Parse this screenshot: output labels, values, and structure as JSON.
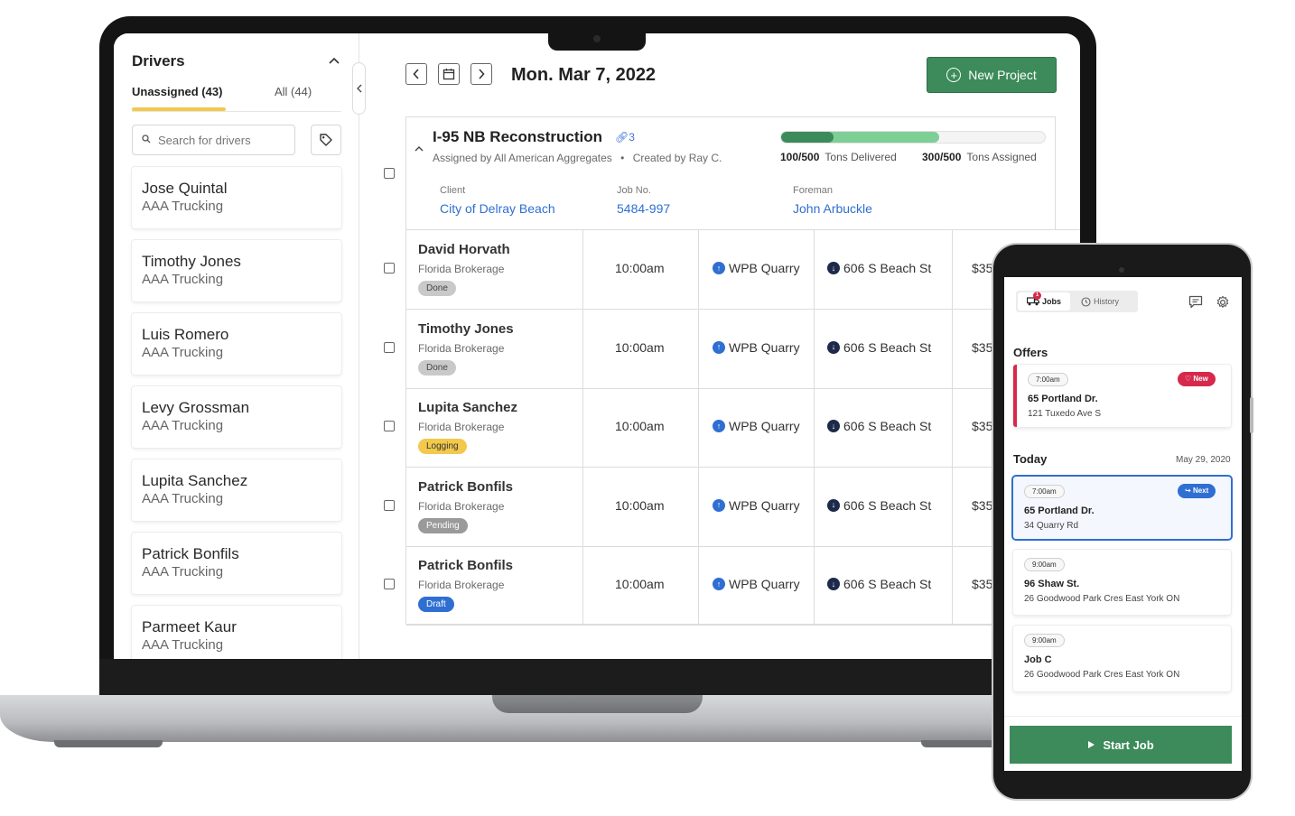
{
  "sidebar": {
    "title": "Drivers",
    "tab_unassigned": "Unassigned (43)",
    "tab_all": "All (44)",
    "search_placeholder": "Search for drivers",
    "drivers": [
      {
        "name": "Jose Quintal",
        "company": "AAA Trucking"
      },
      {
        "name": "Timothy Jones",
        "company": "AAA Trucking"
      },
      {
        "name": "Luis Romero",
        "company": "AAA Trucking"
      },
      {
        "name": "Levy Grossman",
        "company": "AAA Trucking"
      },
      {
        "name": "Lupita Sanchez",
        "company": "AAA Trucking"
      },
      {
        "name": "Patrick Bonfils",
        "company": "AAA Trucking"
      },
      {
        "name": "Parmeet Kaur",
        "company": "AAA Trucking"
      }
    ]
  },
  "header": {
    "date": "Mon. Mar 7, 2022",
    "new_project": "New Project"
  },
  "project": {
    "title": "I-95 NB Reconstruction",
    "link_count": "3",
    "assigned_by": "Assigned by All American Aggregates",
    "created_by": "Created by Ray C.",
    "delivered_value": "100/500",
    "delivered_label": "Tons Delivered",
    "assigned_value": "300/500",
    "assigned_label": "Tons Assigned",
    "delivered_fraction": 0.2,
    "assigned_fraction": 0.6,
    "client_label": "Client",
    "client": "City of Delray Beach",
    "job_label": "Job No.",
    "job_no": "5484-997",
    "foreman_label": "Foreman",
    "foreman": "John Arbuckle"
  },
  "jobs": [
    {
      "driver": "David Horvath",
      "company": "Florida Brokerage",
      "status": "Done",
      "status_color": "#c9c9c9",
      "time": "10:00am",
      "pickup": "WPB Quarry",
      "dropoff": "606 S Beach St",
      "price": "$35"
    },
    {
      "driver": "Timothy Jones",
      "company": "Florida Brokerage",
      "status": "Done",
      "status_color": "#c9c9c9",
      "time": "10:00am",
      "pickup": "WPB Quarry",
      "dropoff": "606 S Beach St",
      "price": "$35"
    },
    {
      "driver": "Lupita Sanchez",
      "company": "Florida Brokerage",
      "status": "Logging",
      "status_color": "#f2c94c",
      "time": "10:00am",
      "pickup": "WPB Quarry",
      "dropoff": "606 S Beach St",
      "price": "$35"
    },
    {
      "driver": "Patrick Bonfils",
      "company": "Florida Brokerage",
      "status": "Pending",
      "status_color": "#9a9a9a",
      "time": "10:00am",
      "pickup": "WPB Quarry",
      "dropoff": "606 S Beach St",
      "price": "$35"
    },
    {
      "driver": "Patrick Bonfils",
      "company": "Florida Brokerage",
      "status": "Draft",
      "status_color": "#2f6fd2",
      "time": "10:00am",
      "pickup": "WPB Quarry",
      "dropoff": "606 S Beach St",
      "price": "$35"
    }
  ],
  "phone": {
    "tab_jobs": "Jobs",
    "jobs_badge": "1",
    "tab_history": "History",
    "offers_heading": "Offers",
    "offer": {
      "time": "7:00am",
      "pill": "New",
      "address": "65 Portland Dr.",
      "sub": "121 Tuxedo Ave S"
    },
    "today_heading": "Today",
    "today_date": "May 29, 2020",
    "today": [
      {
        "time": "7:00am",
        "pill": "Next",
        "address": "65 Portland Dr.",
        "sub": "34 Quarry Rd"
      },
      {
        "time": "9:00am",
        "address": "96 Shaw St.",
        "sub": "26 Goodwood Park Cres East York ON"
      },
      {
        "time": "9:00am",
        "address": "Job C",
        "sub": "26 Goodwood Park Cres East York ON"
      }
    ],
    "start_job": "Start Job"
  },
  "colors": {
    "brand_green": "#3d8b5b",
    "link_blue": "#2f6fd2",
    "accent_yellow": "#f2c94c",
    "offer_red": "#d6294b"
  }
}
